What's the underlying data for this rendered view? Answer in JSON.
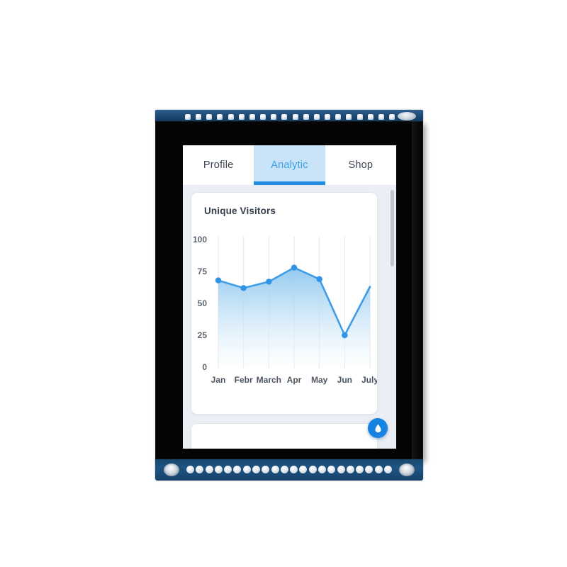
{
  "device": {
    "name": "tft-display-module",
    "pin_count_top": 20,
    "pin_count_bottom": 22
  },
  "tabs": [
    {
      "label": "Profile",
      "active": false
    },
    {
      "label": "Analytic",
      "active": true
    },
    {
      "label": "Shop",
      "active": false
    }
  ],
  "card": {
    "title": "Unique Visitors"
  },
  "fab": {
    "icon": "water-drop-icon"
  },
  "colors": {
    "accent": "#1e8ce0",
    "tab_active_bg": "#c9e4f8",
    "tab_active_text": "#3ba0e8",
    "line": "#3e9ce8",
    "point": "#2f93e6",
    "page_bg": "#eceef6",
    "card_bg": "#ffffff",
    "pcb": "#1d4a75",
    "bezel": "#050505",
    "fab_bg": "#1683e3"
  },
  "chart_data": {
    "type": "area",
    "title": "Unique Visitors",
    "xlabel": "",
    "ylabel": "",
    "categories": [
      "Jan",
      "Febr",
      "March",
      "Apr",
      "May",
      "Jun",
      "July"
    ],
    "values": [
      68,
      62,
      67,
      78,
      69,
      25,
      63
    ],
    "yticks": [
      "100",
      "75",
      "50",
      "25",
      "0"
    ],
    "ytick_values": [
      100,
      75,
      50,
      25,
      0
    ],
    "ylim": [
      0,
      100
    ],
    "grid": "vertical",
    "legend": "none",
    "series": [
      {
        "name": "Unique Visitors",
        "values": [
          68,
          62,
          67,
          78,
          69,
          25,
          63
        ]
      }
    ],
    "notes": "Left y-axis labels clipped by card edge; last x label 'July' clipped at right edge."
  }
}
